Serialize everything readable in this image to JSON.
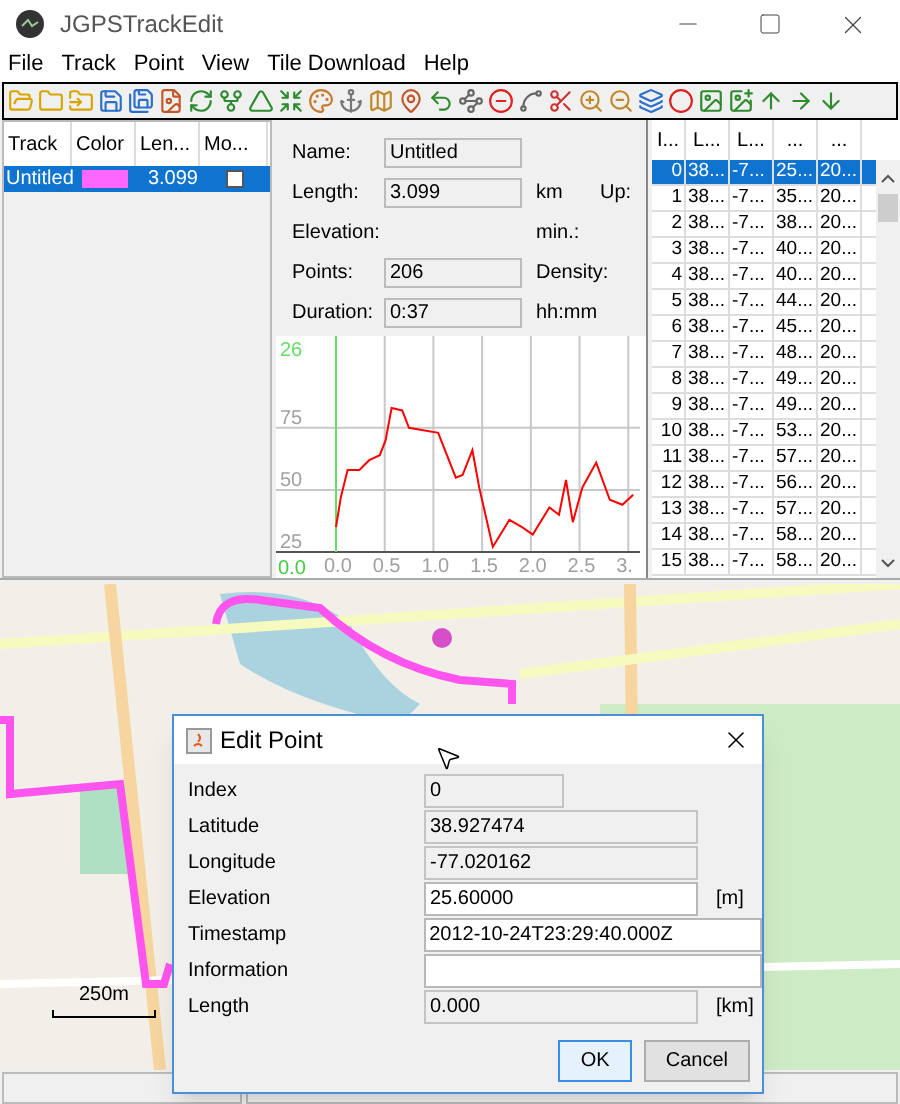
{
  "window": {
    "title": "JGPSTrackEdit"
  },
  "menu": [
    "File",
    "Track",
    "Point",
    "View",
    "Tile Download",
    "Help"
  ],
  "tracks": {
    "columns": [
      "Track",
      "Color",
      "Len...",
      "Mo..."
    ],
    "rows": [
      {
        "name": "Untitled",
        "color": "#ff66ff",
        "length": "3.099",
        "checked": false,
        "selected": true
      }
    ]
  },
  "info": {
    "rows": [
      {
        "label": "Name:",
        "value": "Untitled"
      },
      {
        "label": "Length:",
        "value": "3.099",
        "unit": "km",
        "extra": "Up:"
      },
      {
        "label": "Elevation:",
        "unit": "min.:"
      },
      {
        "label": "Points:",
        "value": "206",
        "unit": "Density:"
      },
      {
        "label": "Duration:",
        "value": "0:37",
        "unit": "hh:mm"
      }
    ]
  },
  "profile": {
    "top_label": "26",
    "origin_label": "0.0",
    "chart_data": {
      "type": "line",
      "x": [
        0,
        0.05,
        0.12,
        0.24,
        0.34,
        0.45,
        0.51,
        0.57,
        0.68,
        0.75,
        1.05,
        1.23,
        1.3,
        1.4,
        1.47,
        1.61,
        1.78,
        1.91,
        2.02,
        2.19,
        2.29,
        2.36,
        2.43,
        2.53,
        2.67,
        2.81,
        2.94,
        3.05
      ],
      "grid": true,
      "series": [
        {
          "color": "#ff0000",
          "values": [
            35,
            47,
            58,
            58,
            62,
            64,
            70,
            83,
            82,
            75,
            73,
            55,
            56,
            66,
            51,
            27,
            38,
            35,
            32,
            43,
            40,
            54,
            37,
            51,
            61,
            46,
            44,
            48
          ]
        }
      ],
      "xlim": [
        0,
        3.1
      ],
      "ylim": [
        25,
        112
      ],
      "xticks": [
        {
          "value": 0,
          "label": "0.0"
        },
        {
          "value": 0.5,
          "label": "0.5"
        },
        {
          "value": 1,
          "label": "1.0"
        },
        {
          "value": 1.5,
          "label": "1.5"
        },
        {
          "value": 2,
          "label": "2.0"
        },
        {
          "value": 2.5,
          "label": "2.5"
        },
        {
          "value": 3,
          "label": "3."
        }
      ],
      "yticks": [
        25,
        50,
        75
      ]
    }
  },
  "points": {
    "columns": [
      "I...",
      "L...",
      "L...",
      "...",
      "..."
    ],
    "rows": [
      {
        "cells": [
          "0",
          "38...",
          "-7...",
          "25...",
          "20..."
        ],
        "selected": true
      },
      {
        "cells": [
          "1",
          "38...",
          "-7...",
          "35...",
          "20..."
        ],
        "selected": false
      },
      {
        "cells": [
          "2",
          "38...",
          "-7...",
          "38...",
          "20..."
        ],
        "selected": false
      },
      {
        "cells": [
          "3",
          "38...",
          "-7...",
          "40...",
          "20..."
        ],
        "selected": false
      },
      {
        "cells": [
          "4",
          "38...",
          "-7...",
          "40...",
          "20..."
        ],
        "selected": false
      },
      {
        "cells": [
          "5",
          "38...",
          "-7...",
          "44...",
          "20..."
        ],
        "selected": false
      },
      {
        "cells": [
          "6",
          "38...",
          "-7...",
          "45...",
          "20..."
        ],
        "selected": false
      },
      {
        "cells": [
          "7",
          "38...",
          "-7...",
          "48...",
          "20..."
        ],
        "selected": false
      },
      {
        "cells": [
          "8",
          "38...",
          "-7...",
          "49...",
          "20..."
        ],
        "selected": false
      },
      {
        "cells": [
          "9",
          "38...",
          "-7...",
          "49...",
          "20..."
        ],
        "selected": false
      },
      {
        "cells": [
          "10",
          "38...",
          "-7...",
          "53...",
          "20..."
        ],
        "selected": false
      },
      {
        "cells": [
          "11",
          "38...",
          "-7...",
          "57...",
          "20..."
        ],
        "selected": false
      },
      {
        "cells": [
          "12",
          "38...",
          "-7...",
          "56...",
          "20..."
        ],
        "selected": false
      },
      {
        "cells": [
          "13",
          "38...",
          "-7...",
          "57...",
          "20..."
        ],
        "selected": false
      },
      {
        "cells": [
          "14",
          "38...",
          "-7...",
          "58...",
          "20..."
        ],
        "selected": false
      },
      {
        "cells": [
          "15",
          "38...",
          "-7...",
          "58...",
          "20..."
        ],
        "selected": false
      }
    ]
  },
  "map": {
    "scale": "250m"
  },
  "dialog": {
    "title": "Edit Point",
    "fields": [
      {
        "label": "Index",
        "value": "0",
        "disabled": true,
        "kind": "short"
      },
      {
        "label": "Latitude",
        "value": "38.927474",
        "disabled": true,
        "kind": "number"
      },
      {
        "label": "Longitude",
        "value": "-77.020162",
        "disabled": true,
        "kind": "number"
      },
      {
        "label": "Elevation",
        "value": "25.60000",
        "disabled": false,
        "kind": "number",
        "unit": "[m]"
      },
      {
        "label": "Timestamp",
        "value": "2012-10-24T23:29:40.000Z",
        "disabled": false,
        "kind": "text"
      },
      {
        "label": "Information",
        "disabled": false,
        "kind": "text"
      },
      {
        "label": "Length",
        "value": "0.000",
        "disabled": true,
        "kind": "number",
        "unit": "[km]"
      }
    ],
    "buttons": [
      {
        "label": "OK",
        "focused": true
      },
      {
        "label": "Cancel",
        "focused": false
      }
    ]
  }
}
